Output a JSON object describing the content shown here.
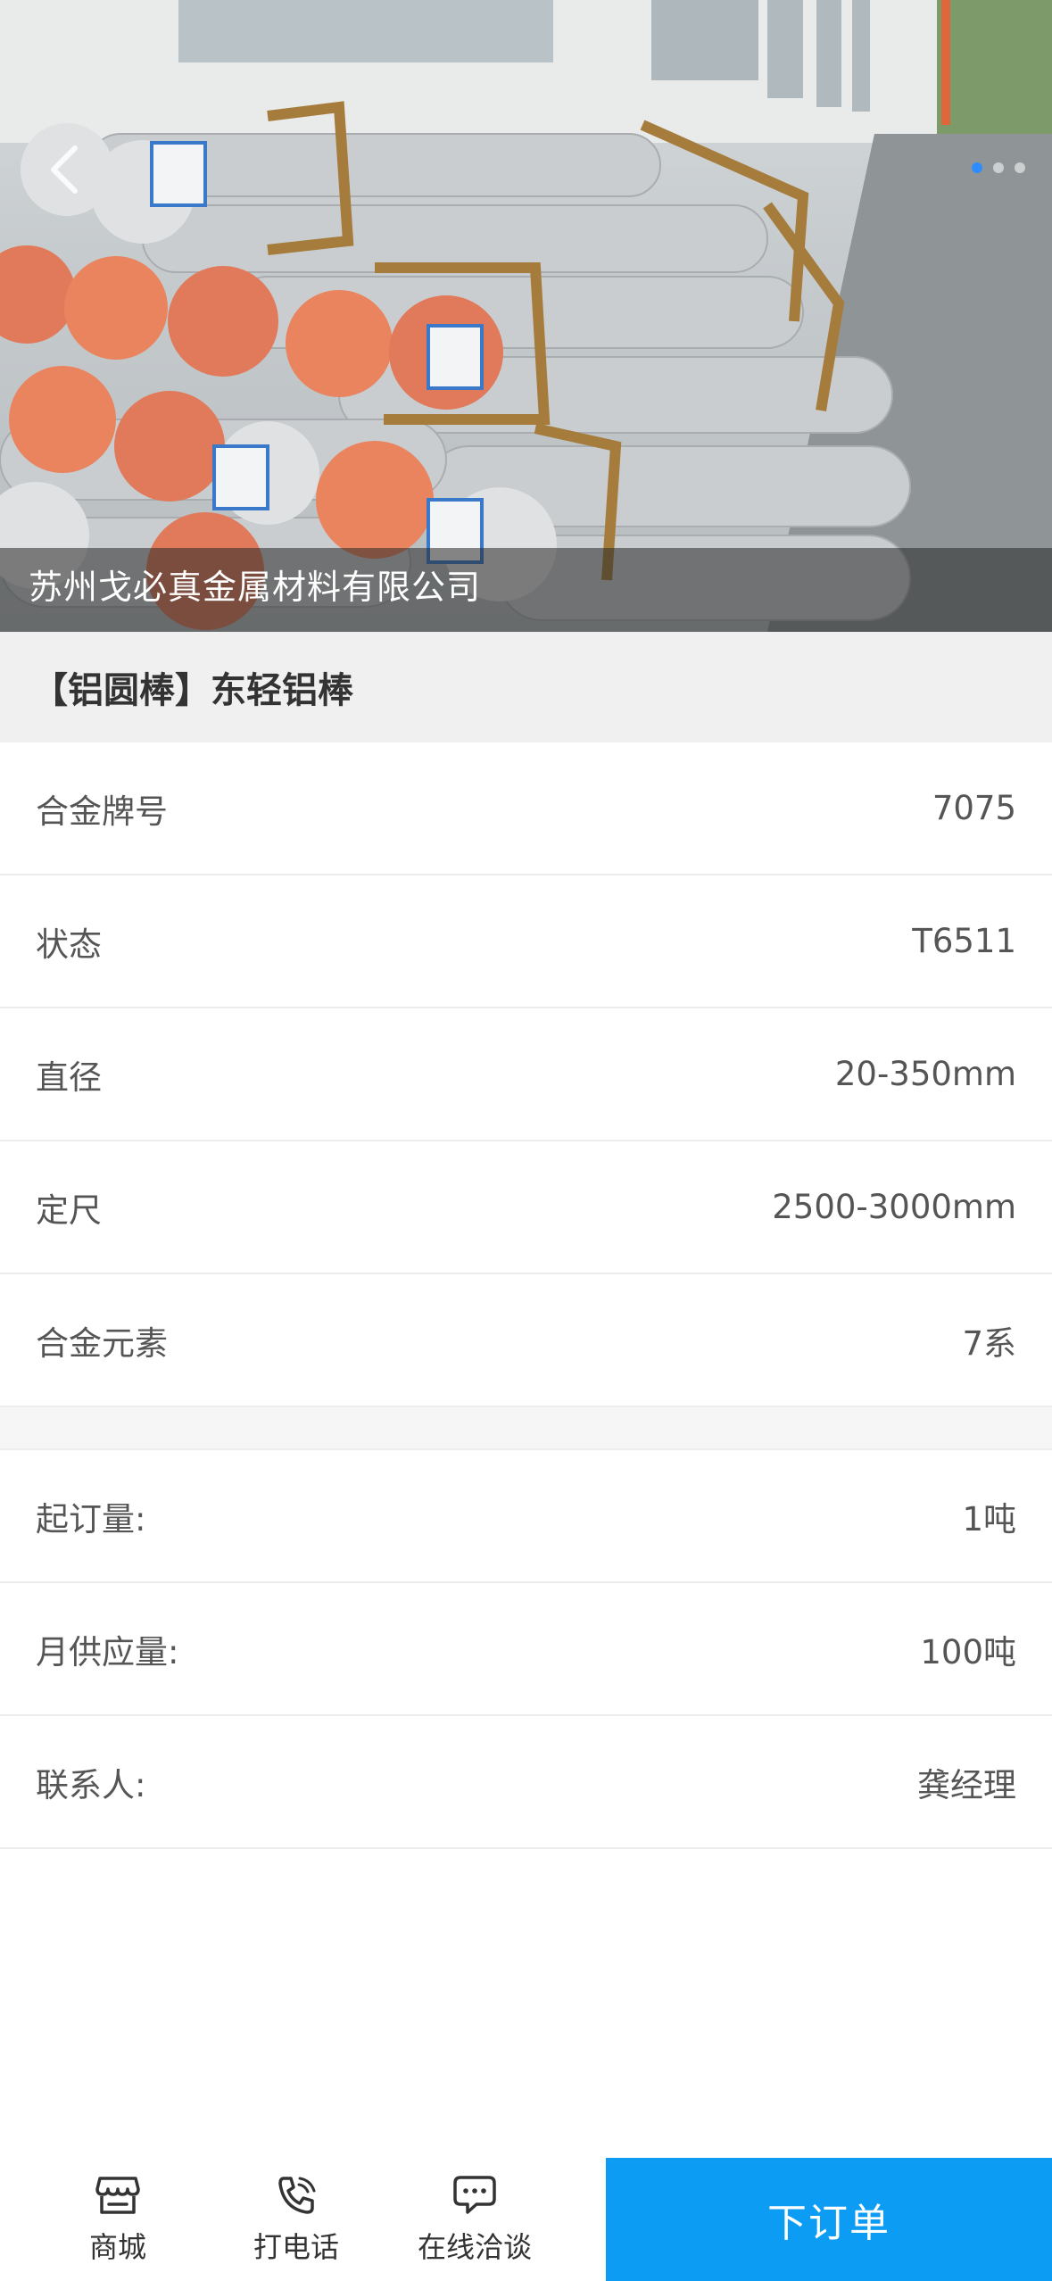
{
  "hero": {
    "company_name": "苏州戈必真金属材料有限公司",
    "slide_count": 3,
    "active_slide": 0
  },
  "product": {
    "title": "【铝圆棒】东轻铝棒"
  },
  "specs": [
    {
      "label": "合金牌号",
      "value": "7075"
    },
    {
      "label": "状态",
      "value": "T6511"
    },
    {
      "label": "直径",
      "value": "20-350mm"
    },
    {
      "label": "定尺",
      "value": "2500-3000mm"
    },
    {
      "label": "合金元素",
      "value": "7系"
    }
  ],
  "supply": [
    {
      "label": "起订量:",
      "value": "1吨"
    },
    {
      "label": "月供应量:",
      "value": "100吨"
    },
    {
      "label": "联系人:",
      "value": "龚经理"
    }
  ],
  "bottom_bar": {
    "tabs": [
      {
        "label": "商城",
        "icon": "store-icon"
      },
      {
        "label": "打电话",
        "icon": "phone-icon"
      },
      {
        "label": "在线洽谈",
        "icon": "chat-icon"
      }
    ],
    "order_button": "下订单"
  },
  "colors": {
    "accent": "#0d9cf3",
    "active_dot": "#2f8cff"
  }
}
